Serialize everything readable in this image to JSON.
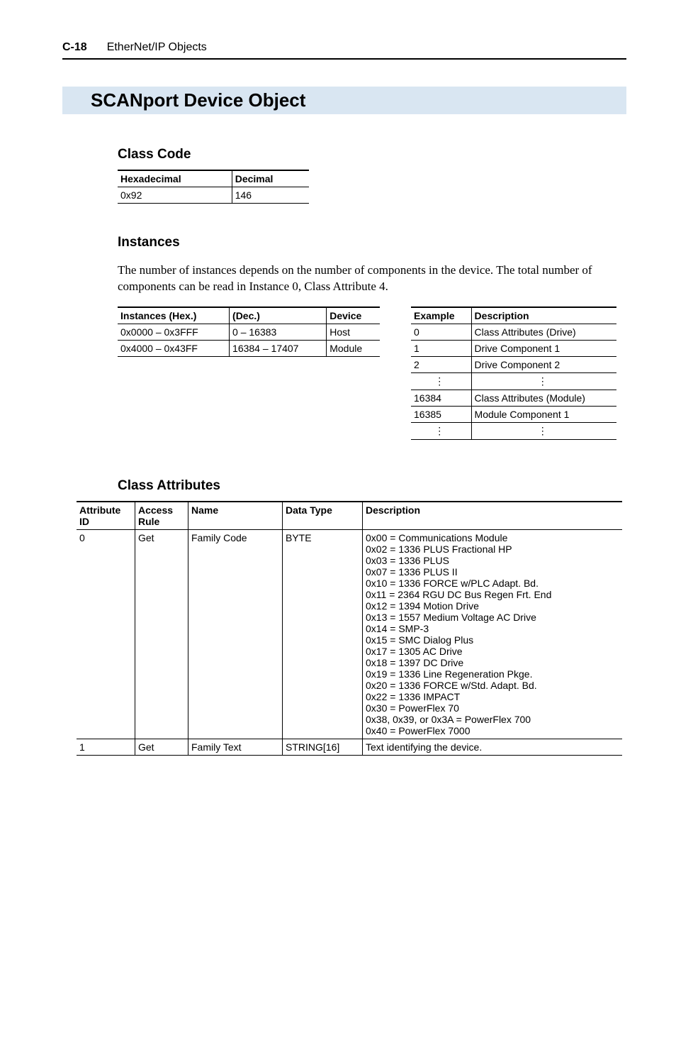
{
  "header": {
    "page_no": "C-18",
    "chapter": "EtherNet/IP Objects"
  },
  "title": "SCANport Device Object",
  "class_code": {
    "heading": "Class Code",
    "cols": [
      "Hexadecimal",
      "Decimal"
    ],
    "rows": [
      [
        "0x92",
        "146"
      ]
    ]
  },
  "instances": {
    "heading": "Instances",
    "body": "The number of instances depends on the number of components in the device. The total number of components can be read in Instance 0, Class Attribute 4.",
    "left": {
      "cols": [
        "Instances (Hex.)",
        "(Dec.)",
        "Device"
      ],
      "rows": [
        [
          "0x0000 – 0x3FFF",
          "0 – 16383",
          "Host"
        ],
        [
          "0x4000 – 0x43FF",
          "16384 – 17407",
          "Module"
        ]
      ]
    },
    "right": {
      "cols": [
        "Example",
        "Description"
      ],
      "rows": [
        [
          "0",
          "Class Attributes (Drive)"
        ],
        [
          "1",
          "Drive Component 1"
        ],
        [
          "2",
          "Drive Component 2"
        ],
        [
          "⋮",
          "⋮"
        ],
        [
          "16384",
          "Class Attributes (Module)"
        ],
        [
          "16385",
          "Module Component 1"
        ],
        [
          "⋮",
          "⋮"
        ]
      ]
    }
  },
  "class_attributes": {
    "heading": "Class Attributes",
    "cols": [
      "Attribute\nID",
      "Access\nRule",
      "Name",
      "Data Type",
      "Description"
    ],
    "rows": [
      {
        "id": "0",
        "rule": "Get",
        "name": "Family Code",
        "type": "BYTE",
        "desc": "0x00 = Communications Module\n0x02 = 1336 PLUS Fractional HP\n0x03 = 1336 PLUS\n0x07 = 1336 PLUS II\n0x10 = 1336 FORCE w/PLC Adapt. Bd.\n0x11 = 2364 RGU DC Bus Regen Frt. End\n0x12 = 1394 Motion Drive\n0x13 = 1557 Medium Voltage AC Drive\n0x14 = SMP-3\n0x15 = SMC Dialog Plus\n0x17 = 1305 AC Drive\n0x18 = 1397 DC Drive\n0x19 = 1336 Line Regeneration Pkge.\n0x20 = 1336 FORCE w/Std. Adapt. Bd.\n0x22 = 1336 IMPACT\n0x30 = PowerFlex 70\n0x38, 0x39, or 0x3A = PowerFlex 700\n0x40 = PowerFlex 7000"
      },
      {
        "id": "1",
        "rule": "Get",
        "name": "Family Text",
        "type": "STRING[16]",
        "desc": "Text identifying the device."
      }
    ]
  }
}
